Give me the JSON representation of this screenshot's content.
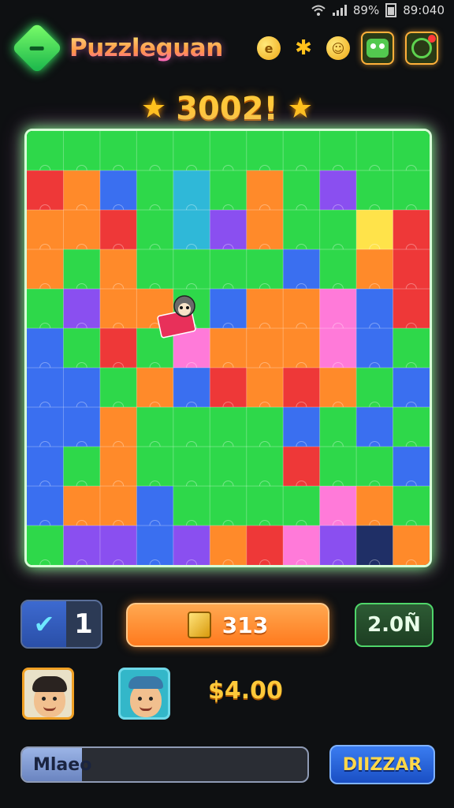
{
  "status_bar": {
    "battery": "89%",
    "time": "89:040",
    "icons": [
      "wifi-icon",
      "signal-icon",
      "battery-icon"
    ]
  },
  "header": {
    "title": "Puzzleguan",
    "icons": [
      "gem-logo-icon",
      "coin-icon",
      "puzzle-coin-icon",
      "smiley-coin-icon",
      "monster-icon",
      "link-icon"
    ]
  },
  "score": {
    "value": "3002!"
  },
  "board": {
    "colors": {
      "green": "#2ed84a",
      "blue": "#3a6ff0",
      "orange": "#ff8a2a",
      "red": "#ee3838",
      "purple": "#8a4ff0",
      "pink": "#ff7ad9",
      "yellow": "#ffe34a",
      "teal": "#2fb8d8",
      "navy": "#1f2f66",
      "lightgreen": "#7de86a"
    },
    "rows": 11,
    "cols": 11,
    "grid": [
      [
        "green",
        "green",
        "green",
        "green",
        "green",
        "green",
        "green",
        "green",
        "green",
        "green",
        "green"
      ],
      [
        "red",
        "orange",
        "blue",
        "green",
        "teal",
        "green",
        "orange",
        "green",
        "purple",
        "green",
        "green"
      ],
      [
        "orange",
        "orange",
        "red",
        "green",
        "teal",
        "purple",
        "orange",
        "green",
        "green",
        "yellow",
        "red"
      ],
      [
        "orange",
        "green",
        "orange",
        "green",
        "green",
        "green",
        "green",
        "blue",
        "green",
        "orange",
        "red"
      ],
      [
        "green",
        "purple",
        "orange",
        "orange",
        "green",
        "blue",
        "orange",
        "orange",
        "pink",
        "blue",
        "red"
      ],
      [
        "blue",
        "green",
        "red",
        "green",
        "pink",
        "orange",
        "orange",
        "orange",
        "pink",
        "blue",
        "green"
      ],
      [
        "blue",
        "blue",
        "green",
        "orange",
        "blue",
        "red",
        "orange",
        "red",
        "orange",
        "green",
        "blue"
      ],
      [
        "blue",
        "blue",
        "orange",
        "green",
        "green",
        "green",
        "green",
        "blue",
        "green",
        "blue",
        "green"
      ],
      [
        "blue",
        "green",
        "orange",
        "green",
        "green",
        "green",
        "green",
        "red",
        "green",
        "green",
        "blue"
      ],
      [
        "blue",
        "orange",
        "orange",
        "blue",
        "green",
        "green",
        "green",
        "green",
        "pink",
        "orange",
        "green"
      ],
      [
        "green",
        "purple",
        "purple",
        "blue",
        "purple",
        "orange",
        "red",
        "pink",
        "purple",
        "navy",
        "orange"
      ]
    ]
  },
  "controls": {
    "check_icon": "check-icon",
    "count": "1",
    "coins": "313",
    "level": "2.0Ñ"
  },
  "players": {
    "money": "$4.00"
  },
  "bottom": {
    "input_value": "Mlaeo",
    "progress": 0.21,
    "action_label": "DIIZZAR"
  }
}
